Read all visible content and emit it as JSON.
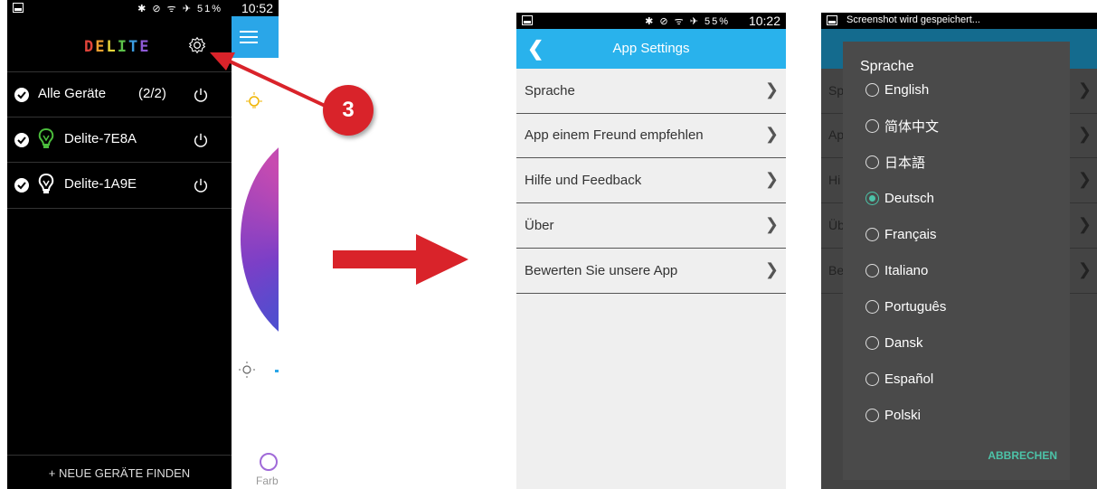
{
  "phone1": {
    "status_icons": "✱ ⊘ ᯤ ✈ 51%",
    "time": "10:52",
    "brand": "DELITE",
    "rows": [
      {
        "label": "Alle Geräte",
        "count": "(2/2)"
      },
      {
        "label": "Delite-7E8A",
        "bulb_color": "#4bbd3c"
      },
      {
        "label": "Delite-1A9E",
        "bulb_color": "#ffffff"
      }
    ],
    "find_devices": "+  NEUE GERÄTE FINDEN",
    "color_tab_label": "Farb"
  },
  "callout_badge": "3",
  "phone2": {
    "status_icons": "✱ ⊘ ᯤ ✈ 55%",
    "time": "10:22",
    "title": "App Settings",
    "items": [
      {
        "label": "Sprache"
      },
      {
        "label": "App einem Freund empfehlen"
      },
      {
        "label": "Hilfe und Feedback"
      },
      {
        "label": "Über"
      },
      {
        "label": "Bewerten Sie unsere App"
      }
    ]
  },
  "phone3": {
    "status_text": "Screenshot wird gespeichert...",
    "bg_items": [
      "Sp",
      "Ap",
      "Hi",
      "Üb",
      "Be"
    ],
    "dialog_title": "Sprache",
    "options": [
      {
        "label": "English",
        "selected": false
      },
      {
        "label": "简体中文",
        "selected": false
      },
      {
        "label": "日本語",
        "selected": false
      },
      {
        "label": "Deutsch",
        "selected": true
      },
      {
        "label": "Français",
        "selected": false
      },
      {
        "label": "Italiano",
        "selected": false
      },
      {
        "label": "Português",
        "selected": false
      },
      {
        "label": "Dansk",
        "selected": false
      },
      {
        "label": "Español",
        "selected": false
      },
      {
        "label": "Polski",
        "selected": false
      }
    ],
    "cancel_label": "ABBRECHEN"
  },
  "colors": {
    "accent_blue": "#29b2ec",
    "callout_red": "#d9232a",
    "radio_accent": "#4cc3a8"
  }
}
